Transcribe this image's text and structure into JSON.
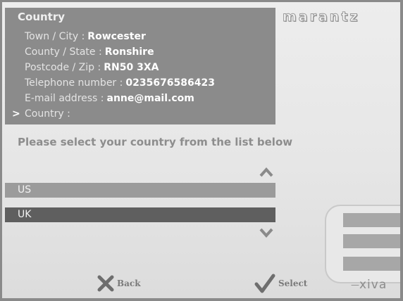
{
  "brand": {
    "logo_text": "marantz",
    "footer_logo": "xiva"
  },
  "details": {
    "title": "Country",
    "rows": [
      {
        "label": "Town / City :",
        "value": "Rowcester"
      },
      {
        "label": "County / State :",
        "value": "Ronshire"
      },
      {
        "label": "Postcode / Zip :",
        "value": "RN50 3XA"
      },
      {
        "label": "Telephone number :",
        "value": "0235676586423"
      },
      {
        "label": "E-mail address :",
        "value": "anne@mail.com"
      },
      {
        "label": "Country :",
        "value": "",
        "marker": ">"
      }
    ]
  },
  "prompt": "Please select your country from the list below",
  "options": [
    {
      "label": "US",
      "selected": false
    },
    {
      "label": "UK",
      "selected": true
    }
  ],
  "buttons": {
    "back": "Back",
    "select": "Select"
  },
  "icons": {
    "up": "chevron-up-icon",
    "down": "chevron-down-icon",
    "back": "x-icon",
    "select": "checkmark-icon"
  }
}
